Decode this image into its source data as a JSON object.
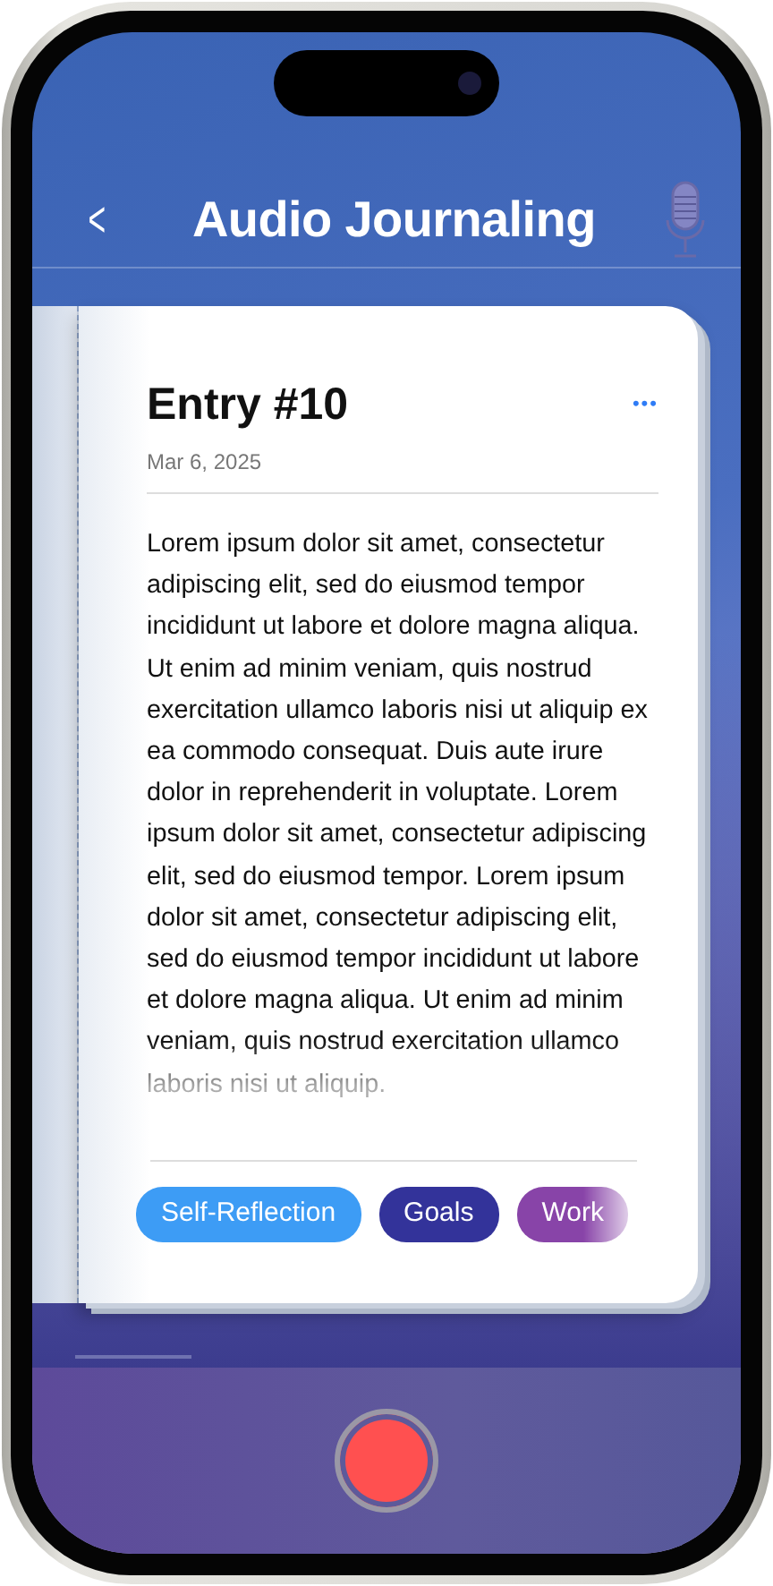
{
  "header": {
    "back": "<",
    "title": "Audio Journaling"
  },
  "entry": {
    "title": "Entry #10",
    "date": "Mar 6, 2025",
    "menu": "•••",
    "body": "Lorem ipsum dolor sit amet, consectetur adipiscing elit, sed do eiusmod tempor incididunt ut labore et dolore magna aliqua. Ut enim ad minim veniam, quis nostrud exercitation ullamco laboris nisi ut aliquip ex ea commodo consequat. Duis aute irure dolor in reprehenderit in voluptate. Lorem ipsum dolor sit amet, consectetur adipiscing elit, sed do eiusmod tempor. Lorem ipsum dolor sit amet, consectetur adipiscing elit, sed do eiusmod tempor incididunt ut labore et dolore magna aliqua. Ut enim ad minim veniam, quis nostrud exercitation ullamco laboris nisi ut aliquip.",
    "tags": [
      {
        "label": "Self-Reflection",
        "color": "#3d9cf5"
      },
      {
        "label": "Goals",
        "color": "#33339a"
      },
      {
        "label": "Work",
        "color": "#8844a8"
      }
    ]
  },
  "record": {
    "recording": false
  }
}
